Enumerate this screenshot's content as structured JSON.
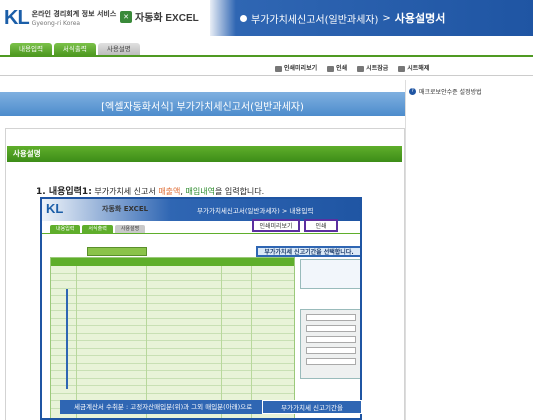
{
  "header": {
    "logo_mark": "KL",
    "logo_line1": "온라인 경리회계 정보 서비스",
    "logo_line2": "Gyeong-ri Korea",
    "product": "자동화 EXCEL",
    "breadcrumb_main": "부가가치세신고서(일반과세자)",
    "breadcrumb_sep": ">",
    "breadcrumb_page": "사용설명서"
  },
  "tabs": [
    {
      "label": "내용입력"
    },
    {
      "label": "서식출력"
    },
    {
      "label": "사용설명"
    }
  ],
  "toolbar": {
    "print_preview": "인쇄미리보기",
    "print": "인쇄",
    "sheet_protect": "시트잠금",
    "sheet_unprotect": "시트해제"
  },
  "side": {
    "label": "매크로보안수준 설정방법"
  },
  "banner": {
    "title": "[엑셀자동화서식] 부가가치세신고서(일반과세자)"
  },
  "section": {
    "title": "사용설명"
  },
  "step1": {
    "num": "1. 내용입력1:",
    "text_a": "부가가치세 신고서 ",
    "text_sales": "매출액",
    "text_b": ", ",
    "text_purchase": "매입내역",
    "text_c": "을 입력합니다."
  },
  "inner": {
    "logo": "KL",
    "product": "자동화 EXCEL",
    "crumb": "부가가치세신고서(일반과세자) > 내용입력",
    "tabs": [
      "내용입력",
      "서식출력",
      "사용설명"
    ],
    "preview_btn": "인쇄미리보기",
    "print_btn": "인쇄",
    "period_hint": "부가가치세 신고기간을 선택합니다.",
    "callout_left": "세금계산서 수취분 : 고정자산매입분(위)과 그외 매입분(아래)으로",
    "callout_right": "부가가치세 신고기간을"
  }
}
